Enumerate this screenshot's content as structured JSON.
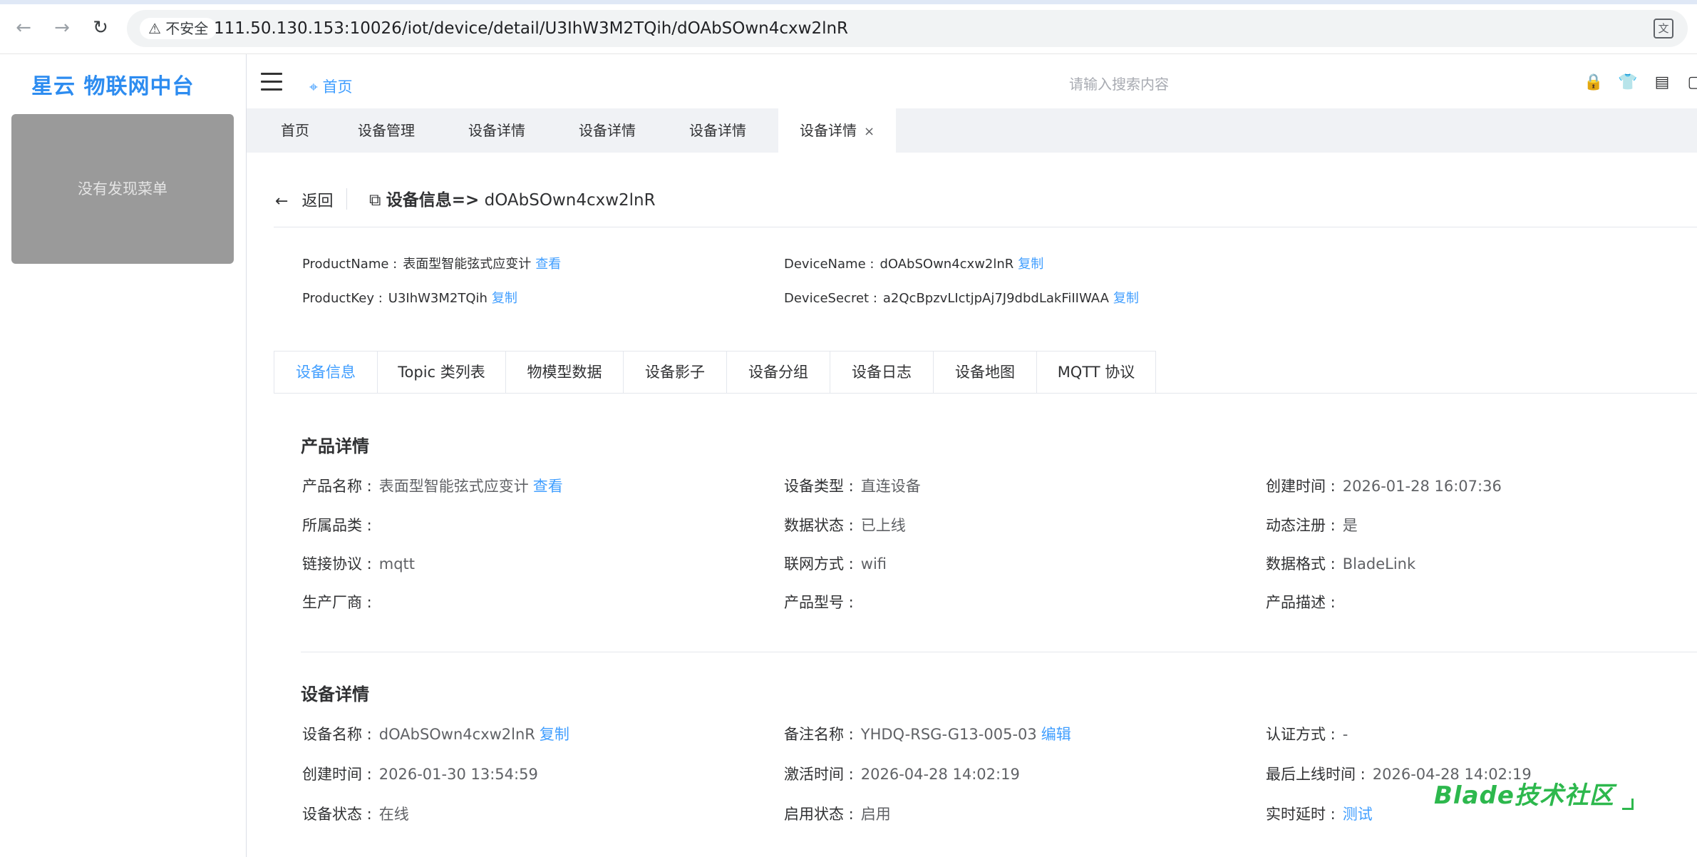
{
  "browser": {
    "insecure_label": "不安全",
    "url": "111.50.130.153:10026/iot/device/detail/U3IhW3M2TQih/dOAbSOwn4cxw2lnR"
  },
  "header": {
    "logo": "星云 物联网中台",
    "home": "首页",
    "search_placeholder": "请输入搜索内容"
  },
  "sidebar": {
    "empty_text": "没有发现菜单"
  },
  "tags": [
    {
      "label": "首页"
    },
    {
      "label": "设备管理"
    },
    {
      "label": "设备详情"
    },
    {
      "label": "设备详情"
    },
    {
      "label": "设备详情"
    },
    {
      "label": "设备详情",
      "close": "×"
    }
  ],
  "page": {
    "back": "返回",
    "title_prefix": "设备信息=>",
    "title_device": "dOAbSOwn4cxw2lnR"
  },
  "summary": {
    "product_name_label": "ProductName :",
    "product_name": "表面型智能弦式应变计",
    "product_name_link": "查看",
    "product_key_label": "ProductKey :",
    "product_key": "U3IhW3M2TQih",
    "product_key_link": "复制",
    "device_name_label": "DeviceName :",
    "device_name": "dOAbSOwn4cxw2lnR",
    "device_name_link": "复制",
    "device_secret_label": "DeviceSecret :",
    "device_secret": "a2QcBpzvLIctjpAj7J9dbdLakFiIIWAA",
    "device_secret_link": "复制"
  },
  "content_tabs": [
    "设备信息",
    "Topic 类列表",
    "物模型数据",
    "设备影子",
    "设备分组",
    "设备日志",
    "设备地图",
    "MQTT 协议"
  ],
  "product": {
    "title": "产品详情",
    "name_k": "产品名称 :",
    "name_v": "表面型智能弦式应变计",
    "name_link": "查看",
    "type_k": "设备类型 :",
    "type_v": "直连设备",
    "created_k": "创建时间 :",
    "created_v": "2026-01-28 16:07:36",
    "category_k": "所属品类 :",
    "category_v": "",
    "datastatus_k": "数据状态 :",
    "datastatus_v": "已上线",
    "dynreg_k": "动态注册 :",
    "dynreg_v": "是",
    "protocol_k": "链接协议 :",
    "protocol_v": "mqtt",
    "network_k": "联网方式 :",
    "network_v": "wifi",
    "format_k": "数据格式 :",
    "format_v": "BladeLink",
    "vendor_k": "生产厂商 :",
    "vendor_v": "",
    "model_k": "产品型号 :",
    "model_v": "",
    "desc_k": "产品描述 :",
    "desc_v": ""
  },
  "device": {
    "title": "设备详情",
    "name_k": "设备名称 :",
    "name_v": "dOAbSOwn4cxw2lnR",
    "name_link": "复制",
    "remark_k": "备注名称 :",
    "remark_v": "YHDQ-RSG-G13-005-03",
    "remark_link": "编辑",
    "auth_k": "认证方式 :",
    "auth_v": "-",
    "created_k": "创建时间 :",
    "created_v": "2026-01-30 13:54:59",
    "activated_k": "激活时间 :",
    "activated_v": "2026-04-28 14:02:19",
    "lastonline_k": "最后上线时间 :",
    "lastonline_v": "2026-04-28 14:02:19",
    "status_k": "设备状态 :",
    "status_v": "在线",
    "enabled_k": "启用状态 :",
    "enabled_v": "启用",
    "latency_k": "实时延时 :",
    "latency_link": "测试"
  },
  "watermark": "Blade技术社区"
}
